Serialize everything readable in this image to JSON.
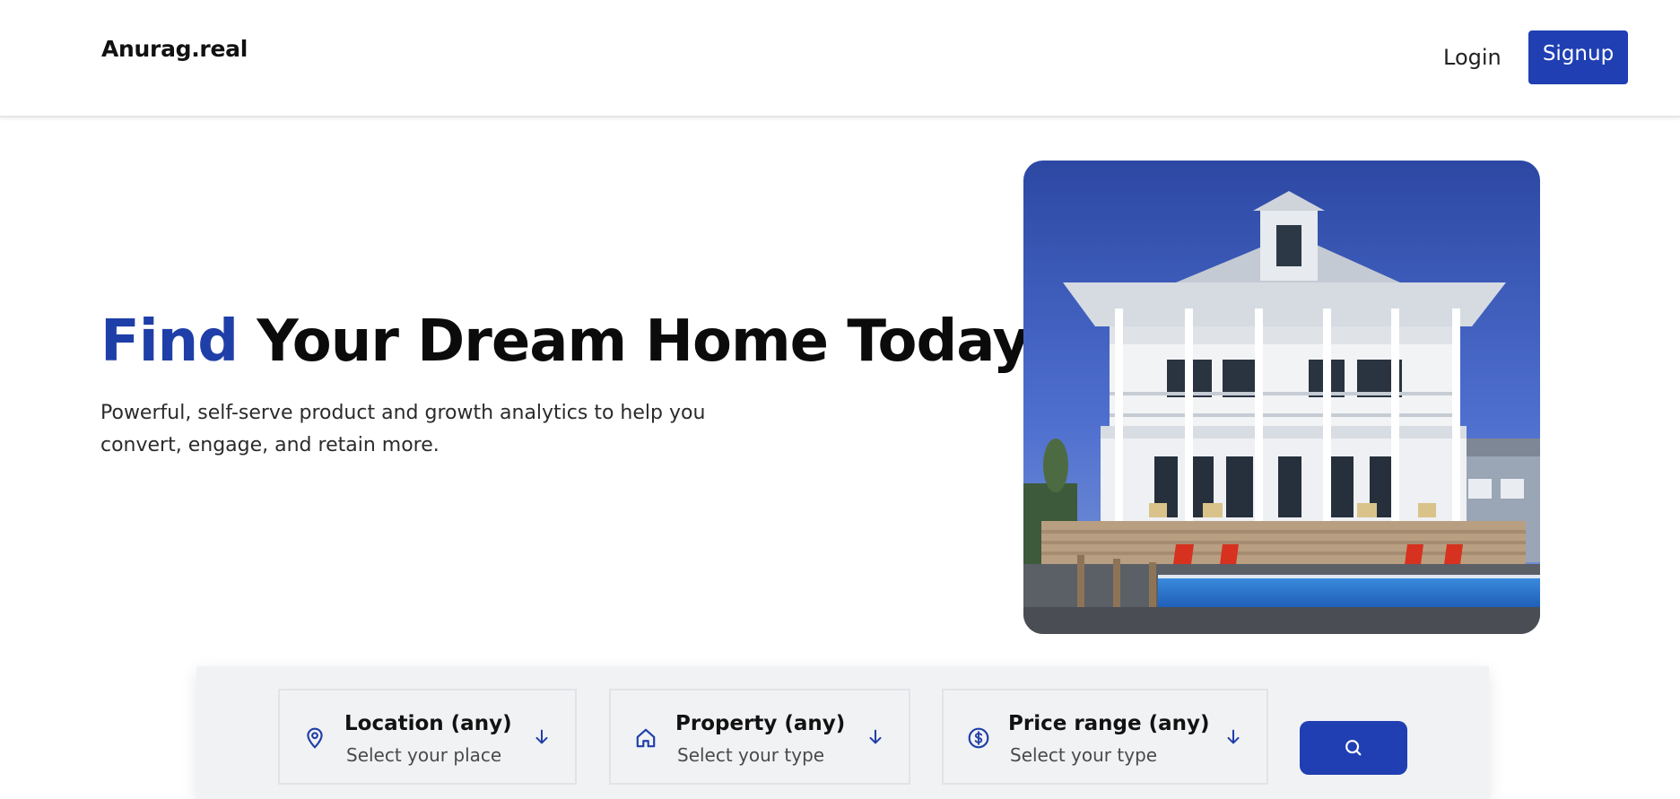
{
  "header": {
    "logo": "Anurag.real",
    "login_label": "Login",
    "signup_label": "Signup"
  },
  "hero": {
    "title_accent": "Find",
    "title_rest": " Your Dream Home Today!",
    "subtitle": "Powerful, self-serve product and growth analytics to help you convert, engage, and retain more.",
    "image": "house-photo"
  },
  "search": {
    "filters": [
      {
        "title": "Location (any)",
        "subtitle": "Select your place",
        "icon": "map-pin-icon",
        "arrow": "arrow-down-icon"
      },
      {
        "title": "Property (any)",
        "subtitle": "Select your type",
        "icon": "home-icon",
        "arrow": "arrow-down-icon"
      },
      {
        "title": "Price range (any)",
        "subtitle": "Select your type",
        "icon": "dollar-circle-icon",
        "arrow": "arrow-down-icon"
      }
    ],
    "button_icon": "search-icon"
  },
  "colors": {
    "accent": "#1f3fb3",
    "title_accent": "#1f3fa8",
    "panel_bg": "#f1f2f4",
    "border": "#e1e3e7"
  }
}
